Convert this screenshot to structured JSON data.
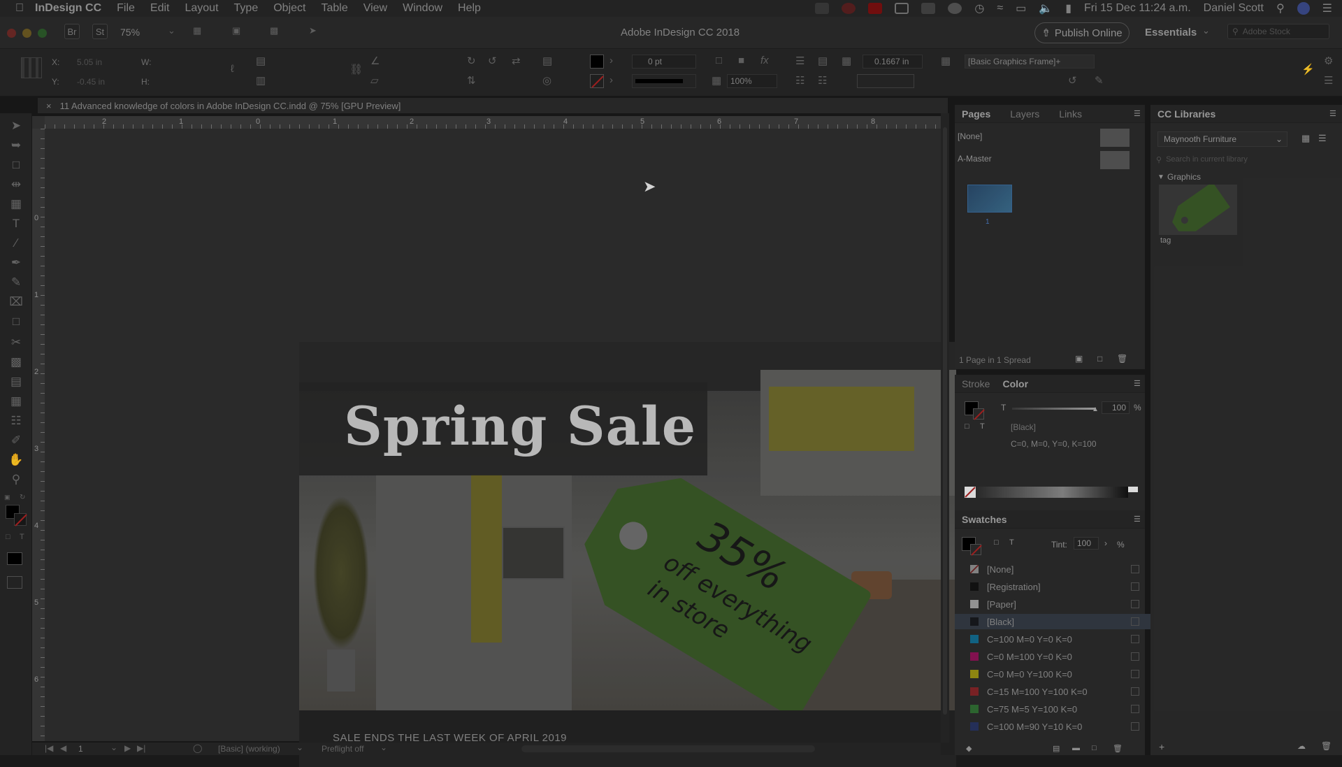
{
  "menubar": {
    "app_name": "InDesign CC",
    "items": [
      "File",
      "Edit",
      "Layout",
      "Type",
      "Object",
      "Table",
      "View",
      "Window",
      "Help"
    ],
    "datetime": "Fri 15 Dec  11:24 a.m.",
    "user": "Daniel Scott"
  },
  "appbar": {
    "br_label": "Br",
    "st_label": "St",
    "zoom": "75%",
    "window_title": "Adobe InDesign CC 2018",
    "publish_label": "Publish Online",
    "workspace": "Essentials",
    "stock_placeholder": "Adobe Stock"
  },
  "control": {
    "x_label": "X:",
    "x_value": "5.05 in",
    "y_label": "Y:",
    "y_value": "-0.45 in",
    "w_label": "W:",
    "h_label": "H:",
    "stroke_weight": "0 pt",
    "opacity": "100%",
    "offset": "0.1667 in",
    "object_style": "[Basic Graphics Frame]+"
  },
  "document": {
    "tab_title": "11 Advanced knowledge of colors in Adobe InDesign CC.indd @ 75% [GPU Preview]",
    "headline": "Spring Sale",
    "tag_line1": "35%",
    "tag_line2": "off everything",
    "tag_line3": "in store",
    "footer_text": "SALE ENDS THE LAST WEEK OF APRIL 2019"
  },
  "rulers": {
    "top": [
      "2",
      "1",
      "0",
      "1",
      "2",
      "3",
      "4",
      "5",
      "6",
      "7",
      "8"
    ],
    "left": [
      "0",
      "1",
      "2",
      "3",
      "4",
      "5",
      "6"
    ]
  },
  "status": {
    "page": "1",
    "style": "[Basic] (working)",
    "preflight": "Preflight off"
  },
  "pages_panel": {
    "tabs": [
      "Pages",
      "Layers",
      "Links"
    ],
    "none_label": "[None]",
    "master_label": "A-Master",
    "page_number": "1",
    "summary": "1 Page in 1 Spread"
  },
  "color_panel": {
    "tabs": [
      "Stroke",
      "Color"
    ],
    "tint_label": "T",
    "tint_value": "100",
    "percent": "%",
    "swatch_name": "[Black]",
    "cmyk": "C=0, M=0, Y=0, K=100"
  },
  "swatches_panel": {
    "title": "Swatches",
    "tint_label": "Tint:",
    "tint_value": "100",
    "percent": "%",
    "items": [
      {
        "name": "[None]",
        "color": "#ffffff"
      },
      {
        "name": "[Registration]",
        "color": "#000000"
      },
      {
        "name": "[Paper]",
        "color": "#ffffff"
      },
      {
        "name": "[Black]",
        "color": "#000000"
      },
      {
        "name": "C=100 M=0 Y=0 K=0",
        "color": "#00a0e0"
      },
      {
        "name": "C=0 M=100 Y=0 K=0",
        "color": "#e0007a"
      },
      {
        "name": "C=0 M=0 Y=100 K=0",
        "color": "#f5e600"
      },
      {
        "name": "C=15 M=100 Y=100 K=0",
        "color": "#cc1f26"
      },
      {
        "name": "C=75 M=5 Y=100 K=0",
        "color": "#35a43d"
      },
      {
        "name": "C=100 M=90 Y=10 K=0",
        "color": "#263a8c"
      }
    ]
  },
  "libraries_panel": {
    "title": "CC Libraries",
    "library": "Maynooth Furniture",
    "search_placeholder": "Search in current library",
    "section": "Graphics",
    "asset_name": "tag"
  }
}
